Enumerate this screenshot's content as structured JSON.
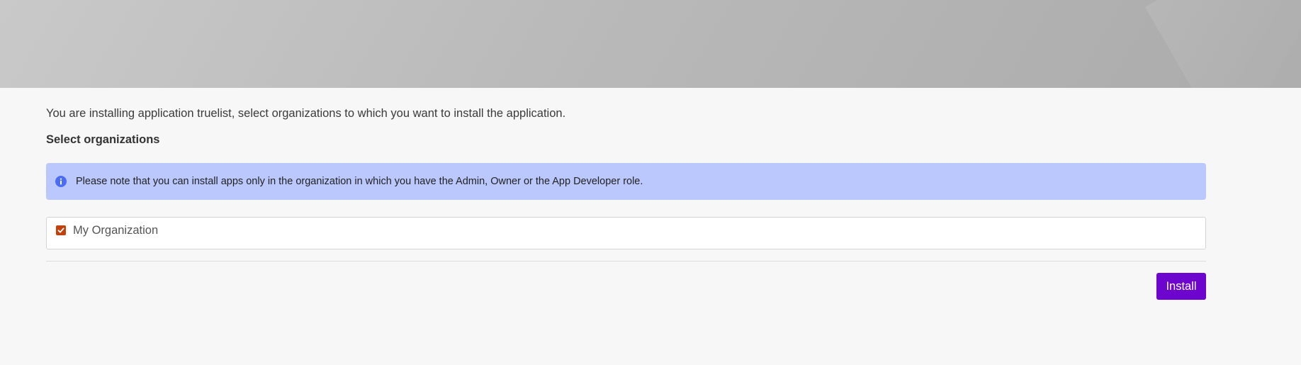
{
  "page": {
    "intro_text": "You are installing application truelist, select organizations to which you want to install the application.",
    "section_title": "Select organizations"
  },
  "notice": {
    "icon": "info-icon",
    "text": "Please note that you can install apps only in the organization in which you have the Admin, Owner or the App Developer role."
  },
  "organizations": [
    {
      "label": "My Organization",
      "checked": true
    }
  ],
  "actions": {
    "install_label": "Install"
  },
  "colors": {
    "accent": "#6e05cf",
    "notice_bg": "#bac8fd",
    "checkbox": "#c2410c",
    "info_icon": "#4a6cf7"
  }
}
